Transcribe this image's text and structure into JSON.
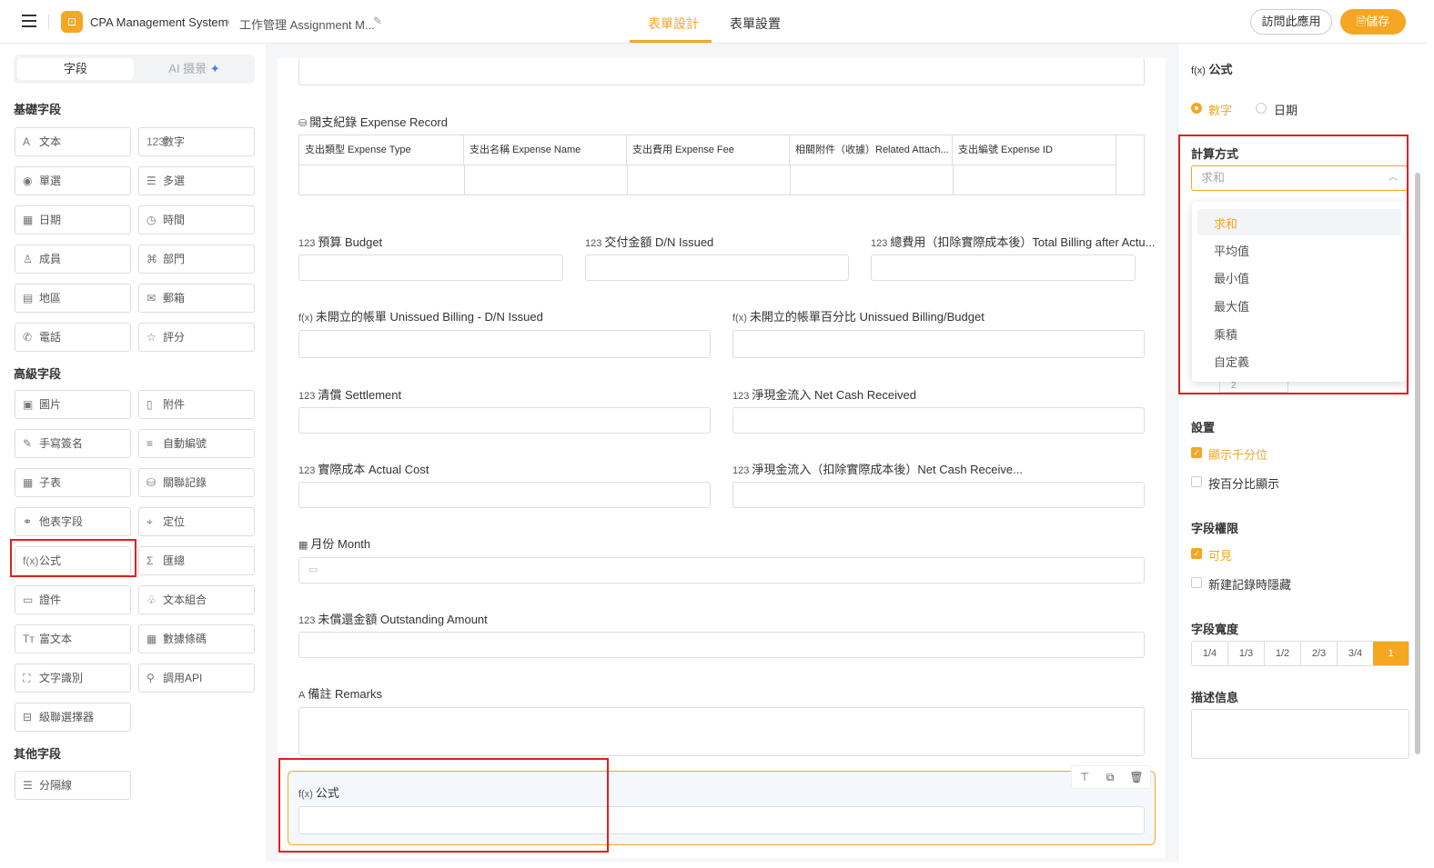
{
  "header": {
    "logo_glyph": "⊡",
    "app_title": "CPA Management System",
    "crumb_sep": "›",
    "breadcrumb": "工作管理 Assignment M...",
    "edit_icon": "✎",
    "tabs": [
      {
        "label": "表單設計",
        "active": true
      },
      {
        "label": "表單設置",
        "active": false
      }
    ],
    "visit_label": "訪問此應用",
    "save_label": "儲存",
    "save_icon": "🗎"
  },
  "left": {
    "seg_fields": "字段",
    "seg_ai": "AI 摄景",
    "spark": "✦",
    "sections": {
      "basic": "基礎字段",
      "advanced": "高級字段",
      "other": "其他字段"
    },
    "basic": [
      {
        "label": "文本",
        "icon": "A"
      },
      {
        "label": "數字",
        "icon": "123"
      },
      {
        "label": "單選",
        "icon": "◉"
      },
      {
        "label": "多選",
        "icon": "☰"
      },
      {
        "label": "日期",
        "icon": "▦"
      },
      {
        "label": "時間",
        "icon": "◷"
      },
      {
        "label": "成員",
        "icon": "♙"
      },
      {
        "label": "部門",
        "icon": "⌘"
      },
      {
        "label": "地區",
        "icon": "▤"
      },
      {
        "label": "郵箱",
        "icon": "✉"
      },
      {
        "label": "電話",
        "icon": "✆"
      },
      {
        "label": "評分",
        "icon": "☆"
      }
    ],
    "advanced": [
      {
        "label": "圖片",
        "icon": "▣"
      },
      {
        "label": "附件",
        "icon": "▯"
      },
      {
        "label": "手寫簽名",
        "icon": "✎"
      },
      {
        "label": "自動編號",
        "icon": "≡"
      },
      {
        "label": "子表",
        "icon": "▦"
      },
      {
        "label": "關聯記錄",
        "icon": "⛁"
      },
      {
        "label": "他表字段",
        "icon": "⚭"
      },
      {
        "label": "定位",
        "icon": "⌖"
      },
      {
        "label": "公式",
        "icon": "f(x)"
      },
      {
        "label": "匯總",
        "icon": "Σ"
      },
      {
        "label": "證件",
        "icon": "▭"
      },
      {
        "label": "文本組合",
        "icon": "♧"
      },
      {
        "label": "富文本",
        "icon": "Tт"
      },
      {
        "label": "數據條碼",
        "icon": "▦"
      },
      {
        "label": "文字識別",
        "icon": "⛶"
      },
      {
        "label": "調用API",
        "icon": "⚲"
      },
      {
        "label": "級聯選擇器",
        "icon": "⊟"
      }
    ],
    "other": [
      {
        "label": "分隔線",
        "icon": "☰"
      }
    ]
  },
  "form": {
    "subtable_title": "開支紀錄 Expense Record",
    "subtable_cols": [
      "支出類型 Expense Type",
      "支出名稱 Expense Name",
      "支出費用 Expense Fee",
      "相關附件（收據）Related Attach...",
      "支出編號 Expense ID"
    ],
    "fields": {
      "budget": "預算 Budget",
      "dn_issued": "交付金額 D/N Issued",
      "total_billing": "總費用（扣除實際成本後）Total Billing after Actu...",
      "unissued": "未開立的帳單 Unissued Billing - D/N Issued",
      "unissued_pct": "未開立的帳單百分比 Unissued Billing/Budget",
      "settlement": "清償 Settlement",
      "net_cash": "淨現金流入 Net Cash Received",
      "actual_cost": "實際成本 Actual Cost",
      "net_cash_after": "淨現金流入（扣除實際成本後）Net Cash Receive...",
      "month": "月份 Month",
      "outstanding": "未償還金額 Outstanding Amount",
      "remarks": "備註 Remarks",
      "formula": "公式"
    },
    "icons": {
      "number": "123",
      "formula": "f(x)",
      "date": "▦",
      "text": "A",
      "db": "⛁",
      "cal": "▭"
    }
  },
  "right": {
    "title": "公式",
    "title_icon": "f(x)",
    "type_options": [
      {
        "label": "數字",
        "selected": true
      },
      {
        "label": "日期",
        "selected": false
      }
    ],
    "calc_label": "計算方式",
    "calc_placeholder": "求和",
    "chevron": "︿",
    "calc_options": [
      "求和",
      "平均值",
      "最小值",
      "最大值",
      "乘積",
      "自定義"
    ],
    "hidden_value": "2",
    "settings_label": "設置",
    "settings": [
      {
        "label": "顯示千分位",
        "checked": true
      },
      {
        "label": "按百分比顯示",
        "checked": false
      }
    ],
    "permission_label": "字段權限",
    "permissions": [
      {
        "label": "可見",
        "checked": true
      },
      {
        "label": "新建記錄時隱藏",
        "checked": false
      }
    ],
    "width_label": "字段寬度",
    "widths": [
      "1/4",
      "1/3",
      "1/2",
      "2/3",
      "3/4",
      "1"
    ],
    "width_selected": "1",
    "desc_label": "描述信息"
  },
  "colors": {
    "accent": "#f5a623",
    "highlight": "#e02020"
  }
}
